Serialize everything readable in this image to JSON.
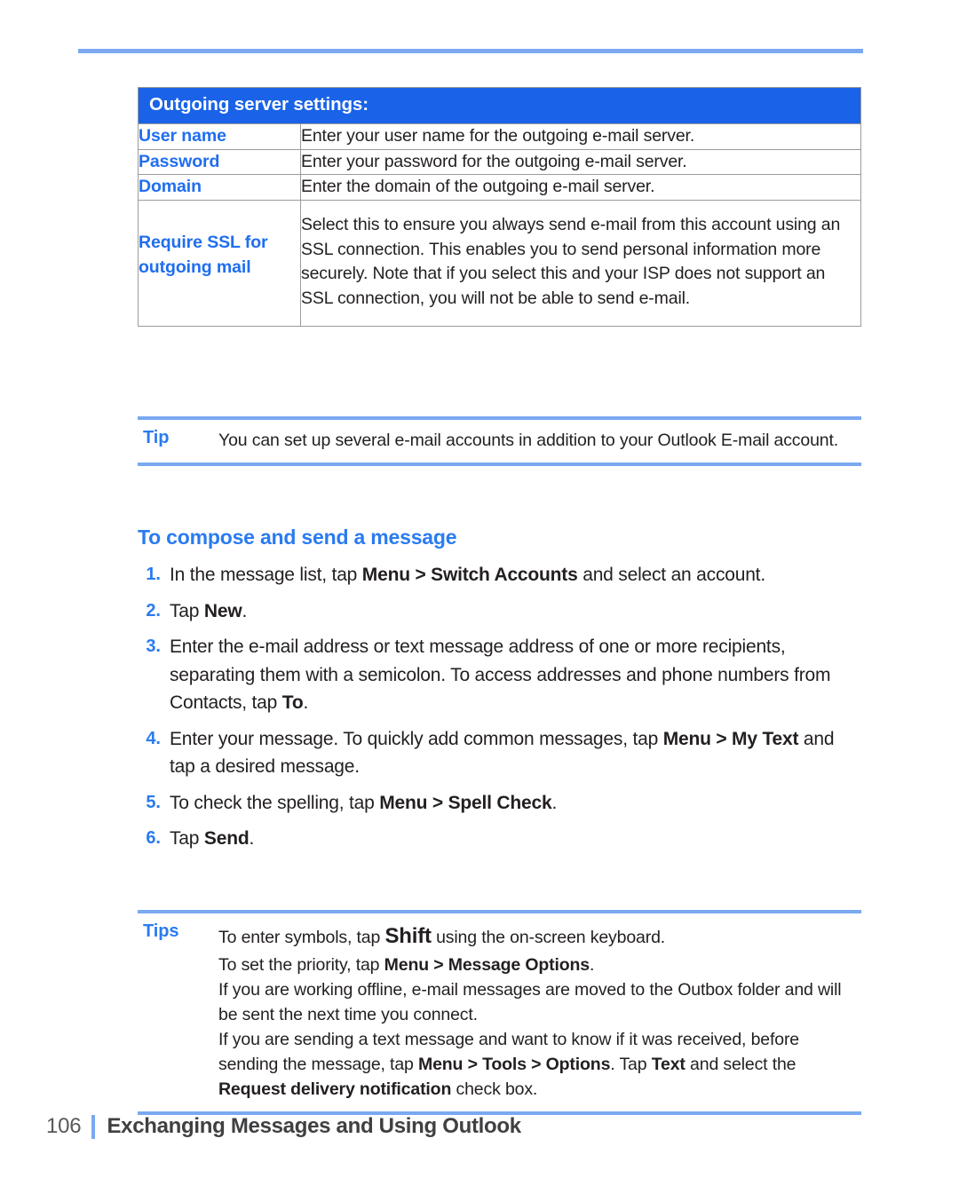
{
  "colors": {
    "heading_blue": "#2a7bf0",
    "label_blue": "#1f6ef0",
    "table_header_blue": "#1a63e8",
    "rule_blue": "#7aa9f0",
    "body_text": "#231f20"
  },
  "table": {
    "header": "Outgoing server settings:",
    "rows": [
      {
        "label": "User name",
        "description": "Enter your user name for the outgoing e-mail server."
      },
      {
        "label": "Password",
        "description": "Enter your password for the outgoing e-mail server."
      },
      {
        "label": "Domain",
        "description": "Enter the domain of the outgoing e-mail server."
      },
      {
        "label": "Require SSL for outgoing mail",
        "description": "Select this to ensure you always send e-mail from this account using an SSL connection. This enables you to send personal information more securely. Note that if you select this and your ISP does not support an SSL connection, you will not be able to send e-mail."
      }
    ]
  },
  "tip_callout": {
    "label": "Tip",
    "text": "You can set up several e-mail accounts in addition to your Outlook E-mail account."
  },
  "section": {
    "heading": "To compose and send a message",
    "steps": [
      {
        "number": "1.",
        "parts": [
          {
            "text": "In the message list, tap ",
            "bold": false
          },
          {
            "text": "Menu > Switch Accounts",
            "bold": true
          },
          {
            "text": " and select an account.",
            "bold": false
          }
        ]
      },
      {
        "number": "2.",
        "parts": [
          {
            "text": "Tap ",
            "bold": false
          },
          {
            "text": "New",
            "bold": true
          },
          {
            "text": ".",
            "bold": false
          }
        ]
      },
      {
        "number": "3.",
        "parts": [
          {
            "text": "Enter the e-mail address or text message address of one or more recipients, separating them with a semicolon. To access addresses and phone numbers from Contacts, tap ",
            "bold": false
          },
          {
            "text": "To",
            "bold": true
          },
          {
            "text": ".",
            "bold": false
          }
        ]
      },
      {
        "number": "4.",
        "parts": [
          {
            "text": "Enter your message. To quickly add common messages, tap ",
            "bold": false
          },
          {
            "text": "Menu > My Text",
            "bold": true
          },
          {
            "text": " and tap a desired message.",
            "bold": false
          }
        ]
      },
      {
        "number": "5.",
        "parts": [
          {
            "text": "To check the spelling, tap ",
            "bold": false
          },
          {
            "text": "Menu > Spell Check",
            "bold": true
          },
          {
            "text": ".",
            "bold": false
          }
        ]
      },
      {
        "number": "6.",
        "parts": [
          {
            "text": "Tap ",
            "bold": false
          },
          {
            "text": "Send",
            "bold": true
          },
          {
            "text": ".",
            "bold": false
          }
        ]
      }
    ]
  },
  "tips_callout": {
    "label": "Tips",
    "lines": [
      [
        {
          "text": "To enter symbols, tap ",
          "bold": false
        },
        {
          "text": "Shift",
          "bold": true,
          "keycap": true
        },
        {
          "text": " using the on-screen keyboard.",
          "bold": false
        }
      ],
      [
        {
          "text": "To set the priority, tap ",
          "bold": false
        },
        {
          "text": "Menu > Message Options",
          "bold": true
        },
        {
          "text": ".",
          "bold": false
        }
      ],
      [
        {
          "text": "If you are working offline, e-mail messages are moved to the Outbox folder and will be sent the next time you connect.",
          "bold": false
        }
      ],
      [
        {
          "text": "If you are sending a text message and want to know if it was received, before sending the message, tap ",
          "bold": false
        },
        {
          "text": "Menu > Tools > Options",
          "bold": true
        },
        {
          "text": ". Tap ",
          "bold": false
        },
        {
          "text": "Text",
          "bold": true
        },
        {
          "text": " and select the ",
          "bold": false
        },
        {
          "text": "Request delivery notification",
          "bold": true
        },
        {
          "text": " check box.",
          "bold": false
        }
      ]
    ]
  },
  "footer": {
    "page_number": "106",
    "chapter_title": "Exchanging Messages and Using Outlook"
  }
}
